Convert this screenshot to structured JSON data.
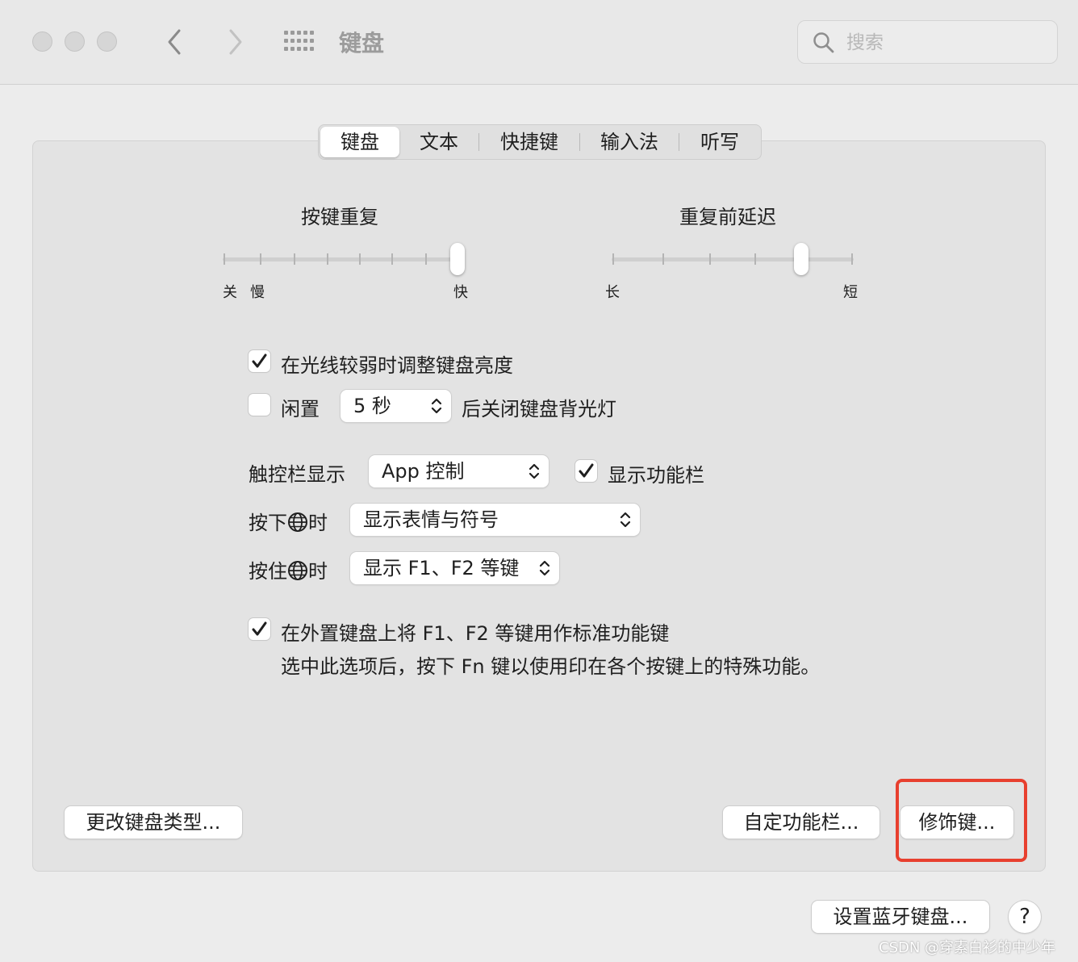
{
  "window": {
    "title": "键盘",
    "search_placeholder": "搜索"
  },
  "tabs": [
    {
      "label": "键盘",
      "active": true
    },
    {
      "label": "文本",
      "active": false
    },
    {
      "label": "快捷键",
      "active": false
    },
    {
      "label": "输入法",
      "active": false
    },
    {
      "label": "听写",
      "active": false
    }
  ],
  "key_repeat": {
    "title": "按键重复",
    "label_off": "关",
    "label_slow": "慢",
    "label_fast": "快"
  },
  "delay_until_repeat": {
    "title": "重复前延迟",
    "label_long": "长",
    "label_short": "短"
  },
  "options": {
    "adjust_brightness": {
      "label": "在光线较弱时调整键盘亮度",
      "checked": true
    },
    "idle_backlight": {
      "prefix": "闲置",
      "value": "5 秒",
      "suffix": "后关闭键盘背光灯",
      "checked": false
    },
    "touchbar": {
      "label": "触控栏显示",
      "value": "App 控制"
    },
    "show_fn_strip": {
      "label": "显示功能栏",
      "checked": true
    },
    "press_globe": {
      "label_prefix": "按下",
      "label_suffix": "时",
      "value": "显示表情与符号"
    },
    "hold_globe": {
      "label_prefix": "按住",
      "label_suffix": "时",
      "value": "显示 F1、F2 等键"
    },
    "std_function_keys": {
      "label": "在外置键盘上将 F1、F2 等键用作标准功能键",
      "description": "选中此选项后，按下 Fn 键以使用印在各个按键上的特殊功能。",
      "checked": true
    }
  },
  "buttons": {
    "change_type": "更改键盘类型...",
    "customize_touchbar": "自定功能栏...",
    "modifier_keys": "修饰键...",
    "bluetooth": "设置蓝牙键盘...",
    "help": "?"
  },
  "watermark": "CSDN @穿素白衫的中少年",
  "colors": {
    "highlight": "#e8402f"
  }
}
